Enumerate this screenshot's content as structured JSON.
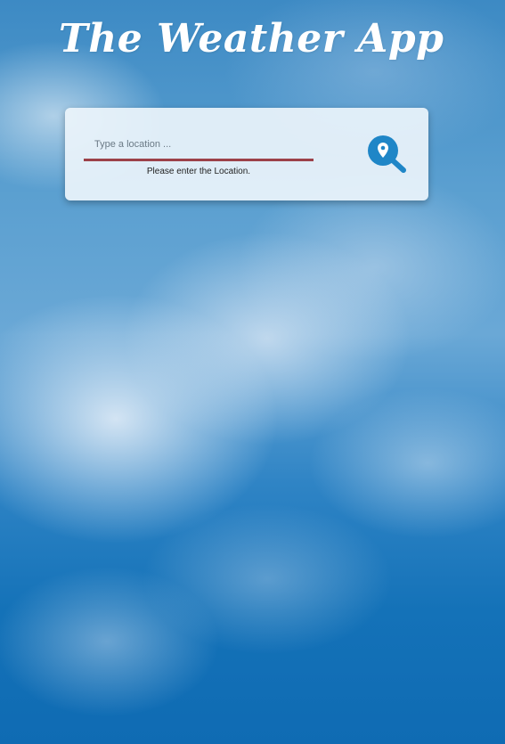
{
  "app": {
    "title": "The Weather App"
  },
  "search": {
    "placeholder": "Type a location ...",
    "value": "",
    "error_message": "Please enter the Location.",
    "button_icon": "location-search-icon"
  },
  "colors": {
    "accent": "#1f86c7",
    "error_underline": "#9c4149",
    "card_background": "#ecf4fb"
  }
}
